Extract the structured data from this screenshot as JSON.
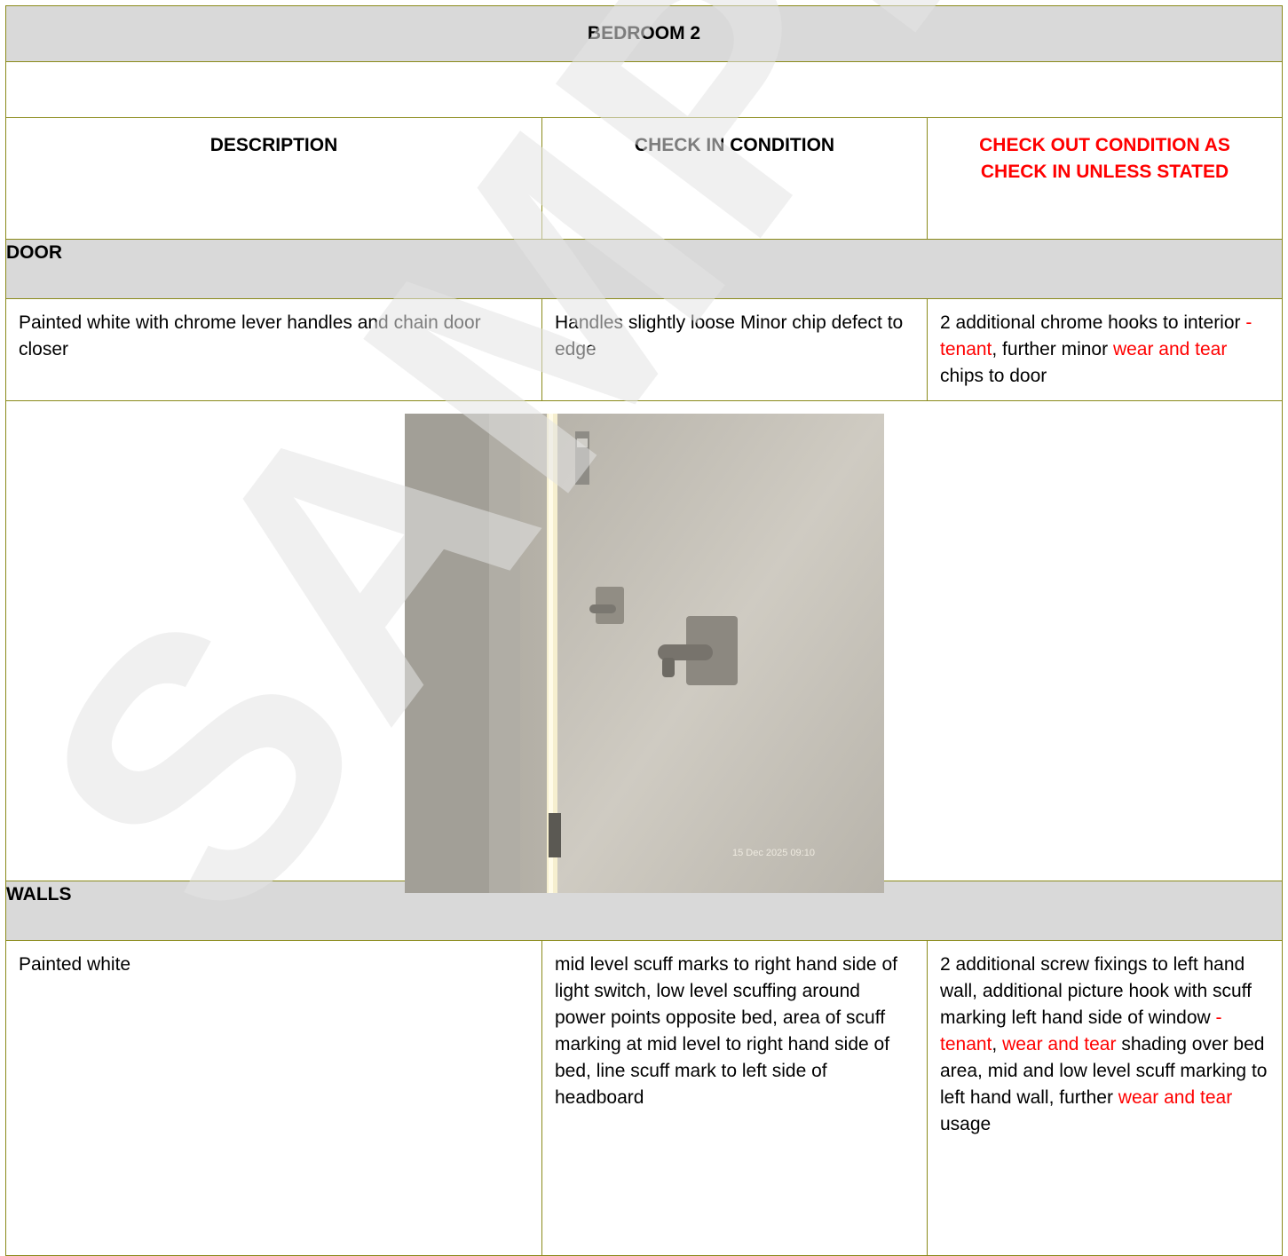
{
  "room_title": "BEDROOM 2",
  "columns": {
    "description": "DESCRIPTION",
    "check_in": "CHECK IN CONDITION",
    "check_out": "CHECK OUT CONDITION AS CHECK IN UNLESS STATED"
  },
  "sections": [
    {
      "name": "DOOR",
      "description": "Painted white with chrome lever handles and chain door closer",
      "check_in": "Handles slightly loose Minor chip defect to edge",
      "check_out": [
        {
          "text": "2 additional chrome hooks to interior ",
          "red": false
        },
        {
          "text": "- tenant",
          "red": true
        },
        {
          "text": ", further minor ",
          "red": false
        },
        {
          "text": "wear and tear",
          "red": true
        },
        {
          "text": " chips to door",
          "red": false
        }
      ],
      "photo_timestamp": "15 Dec 2025 09:10"
    },
    {
      "name": "WALLS",
      "description": "Painted white",
      "check_in": "mid level scuff marks to right hand side of light switch, low level scuffing around power points opposite bed, area of scuff marking at mid level to right hand side of bed, line scuff mark to left side of headboard",
      "check_out": [
        {
          "text": "2 additional screw fixings to left hand wall, additional picture hook with scuff marking left hand side of window ",
          "red": false
        },
        {
          "text": "- tenant",
          "red": true
        },
        {
          "text": ", ",
          "red": false
        },
        {
          "text": "wear and tear",
          "red": true
        },
        {
          "text": " shading over bed area, mid and low level scuff marking to left hand wall, further ",
          "red": false
        },
        {
          "text": "wear and tear",
          "red": true
        },
        {
          "text": " usage",
          "red": false
        }
      ]
    }
  ],
  "watermark": "SAMPLE",
  "colors": {
    "border": "#8a8a1a",
    "header_bg": "#d9d9d9",
    "red": "#ff0000",
    "watermark": "#e0e0e0"
  }
}
